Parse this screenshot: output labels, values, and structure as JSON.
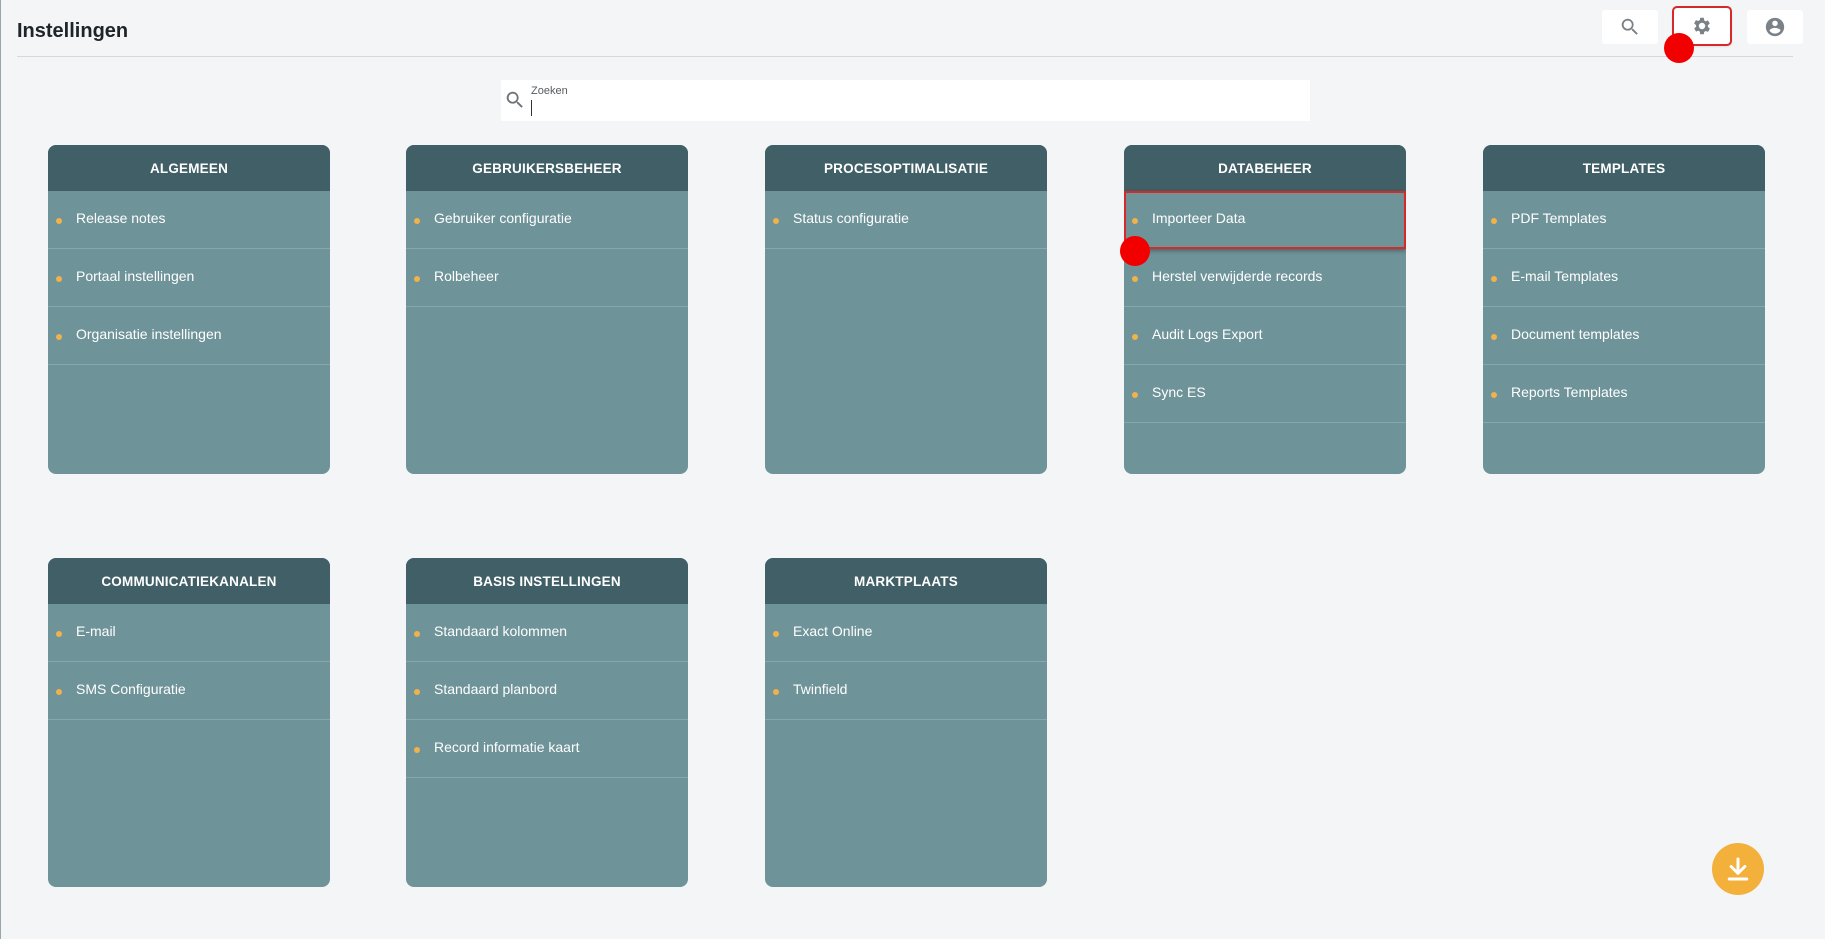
{
  "page": {
    "title": "Instellingen"
  },
  "search": {
    "label": "Zoeken",
    "value": ""
  },
  "top_actions": [
    {
      "name": "search-icon"
    },
    {
      "name": "gear-icon"
    },
    {
      "name": "account-icon"
    }
  ],
  "colors": {
    "card_header": "#405f66",
    "card_body": "#6e9399",
    "bullet": "#f0b24a",
    "fab": "#f3b03b",
    "highlight": "#d42a2a",
    "click_marker": "#f20000"
  },
  "cards": [
    {
      "title": "ALGEMEEN",
      "items": [
        "Release notes",
        "Portaal instellingen",
        "Organisatie instellingen"
      ]
    },
    {
      "title": "GEBRUIKERSBEHEER",
      "items": [
        "Gebruiker configuratie",
        "Rolbeheer"
      ]
    },
    {
      "title": "PROCESOPTIMALISATIE",
      "items": [
        "Status configuratie"
      ]
    },
    {
      "title": "DATABEHEER",
      "items": [
        "Importeer Data",
        "Herstel verwijderde records",
        "Audit Logs Export",
        "Sync ES"
      ]
    },
    {
      "title": "TEMPLATES",
      "items": [
        "PDF Templates",
        "E-mail Templates",
        "Document templates",
        "Reports Templates"
      ]
    },
    {
      "title": "COMMUNICATIEKANALEN",
      "items": [
        "E-mail",
        "SMS Configuratie"
      ]
    },
    {
      "title": "BASIS INSTELLINGEN",
      "items": [
        "Standaard kolommen",
        "Standaard planbord",
        "Record informatie kaart"
      ]
    },
    {
      "title": "MARKTPLAATS",
      "items": [
        "Exact Online",
        "Twinfield"
      ]
    }
  ],
  "fab": {
    "icon": "download-icon"
  }
}
